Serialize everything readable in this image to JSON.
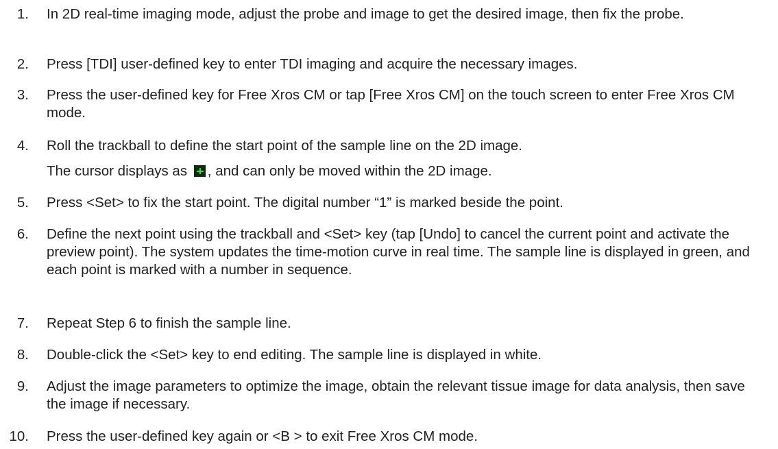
{
  "steps": [
    {
      "number": "1.",
      "text": "In 2D real-time imaging mode, adjust the probe and image to get the desired image, then fix the probe."
    },
    {
      "number": "2.",
      "text": "Press [TDI] user-defined key to enter TDI imaging and acquire the necessary images."
    },
    {
      "number": "3.",
      "text": "Press the user-defined key for Free Xros CM or tap [Free Xros CM] on the touch screen to enter Free Xros CM mode."
    },
    {
      "number": "4.",
      "text": "Roll the trackball to define the start point of the sample line on the 2D image.",
      "note_before_icon": "The cursor displays as",
      "note_icon": "green-plus-cursor",
      "note_after_icon": ", and can only be moved within the 2D image."
    },
    {
      "number": "5.",
      "text": "Press <Set> to fix the start point. The digital number “1” is marked beside the point."
    },
    {
      "number": "6.",
      "text": "Define the next point using the trackball and <Set> key (tap [Undo] to cancel the current point and activate the preview point). The system updates the time-motion curve in real time. The sample line is displayed in green, and each point is marked with a number in sequence."
    },
    {
      "number": "7.",
      "text": "Repeat Step 6 to finish the sample line."
    },
    {
      "number": "8.",
      "text": "Double-click the <Set> key to end editing. The sample line is displayed in white."
    },
    {
      "number": "9.",
      "text": "Adjust the image parameters to optimize the image, obtain the relevant tissue image for data analysis, then save the image if necessary."
    },
    {
      "number": "10.",
      "text": "Press the user-defined key again or <B > to exit Free Xros CM mode."
    }
  ],
  "colors": {
    "text": "#222222",
    "cursor_icon_bg": "#102a12",
    "cursor_icon_plus": "#22e53a"
  }
}
